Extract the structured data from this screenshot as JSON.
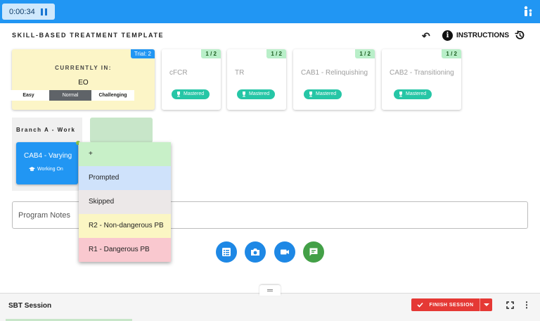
{
  "topbar": {
    "timer": "0:00:34",
    "user_icon": "person-icon"
  },
  "header": {
    "title": "SKILL-BASED TREATMENT TEMPLATE",
    "instructions_label": "INSTRUCTIONS",
    "icons": [
      "undo-icon",
      "info-icon",
      "history-icon"
    ]
  },
  "current": {
    "trial_badge": "Trial: 2",
    "label": "CURRENTLY IN:",
    "target": "EO",
    "difficulty": [
      "Easy",
      "Normal",
      "Challenging"
    ],
    "selected_difficulty": "Normal"
  },
  "targets": [
    {
      "name": "cFCR",
      "ratio": "1 / 2",
      "status": "Mastered"
    },
    {
      "name": "TR",
      "ratio": "1 / 2",
      "status": "Mastered"
    },
    {
      "name": "CAB1 - Relinquishing",
      "ratio": "1 / 2",
      "status": "Mastered"
    },
    {
      "name": "CAB2 - Transitioning",
      "ratio": "1 / 2",
      "status": "Mastered"
    }
  ],
  "branch": {
    "title": "Branch A - Work",
    "card_name": "CAB4 - Varying",
    "card_status": "Working On"
  },
  "menu": {
    "items": [
      {
        "label": "+",
        "color": "#c8f0c8"
      },
      {
        "label": "Prompted",
        "color": "#cfe2fb"
      },
      {
        "label": "Skipped",
        "color": "#ece8e8"
      },
      {
        "label": "R2 - Non-dangerous PB",
        "color": "#fbf6c3"
      },
      {
        "label": "R1 - Dangerous PB",
        "color": "#f9c8cf"
      }
    ]
  },
  "notes": {
    "label": "Program Notes"
  },
  "actions": [
    "notes-icon",
    "camera-icon",
    "video-icon",
    "chat-icon"
  ],
  "bottom": {
    "session_title": "SBT Session",
    "finish_label": "FINISH SESSION"
  },
  "colors": {
    "primary": "#2196f3",
    "mastered": "#26c6a6",
    "finish": "#e53935",
    "current_bg": "#fcf5c7"
  }
}
